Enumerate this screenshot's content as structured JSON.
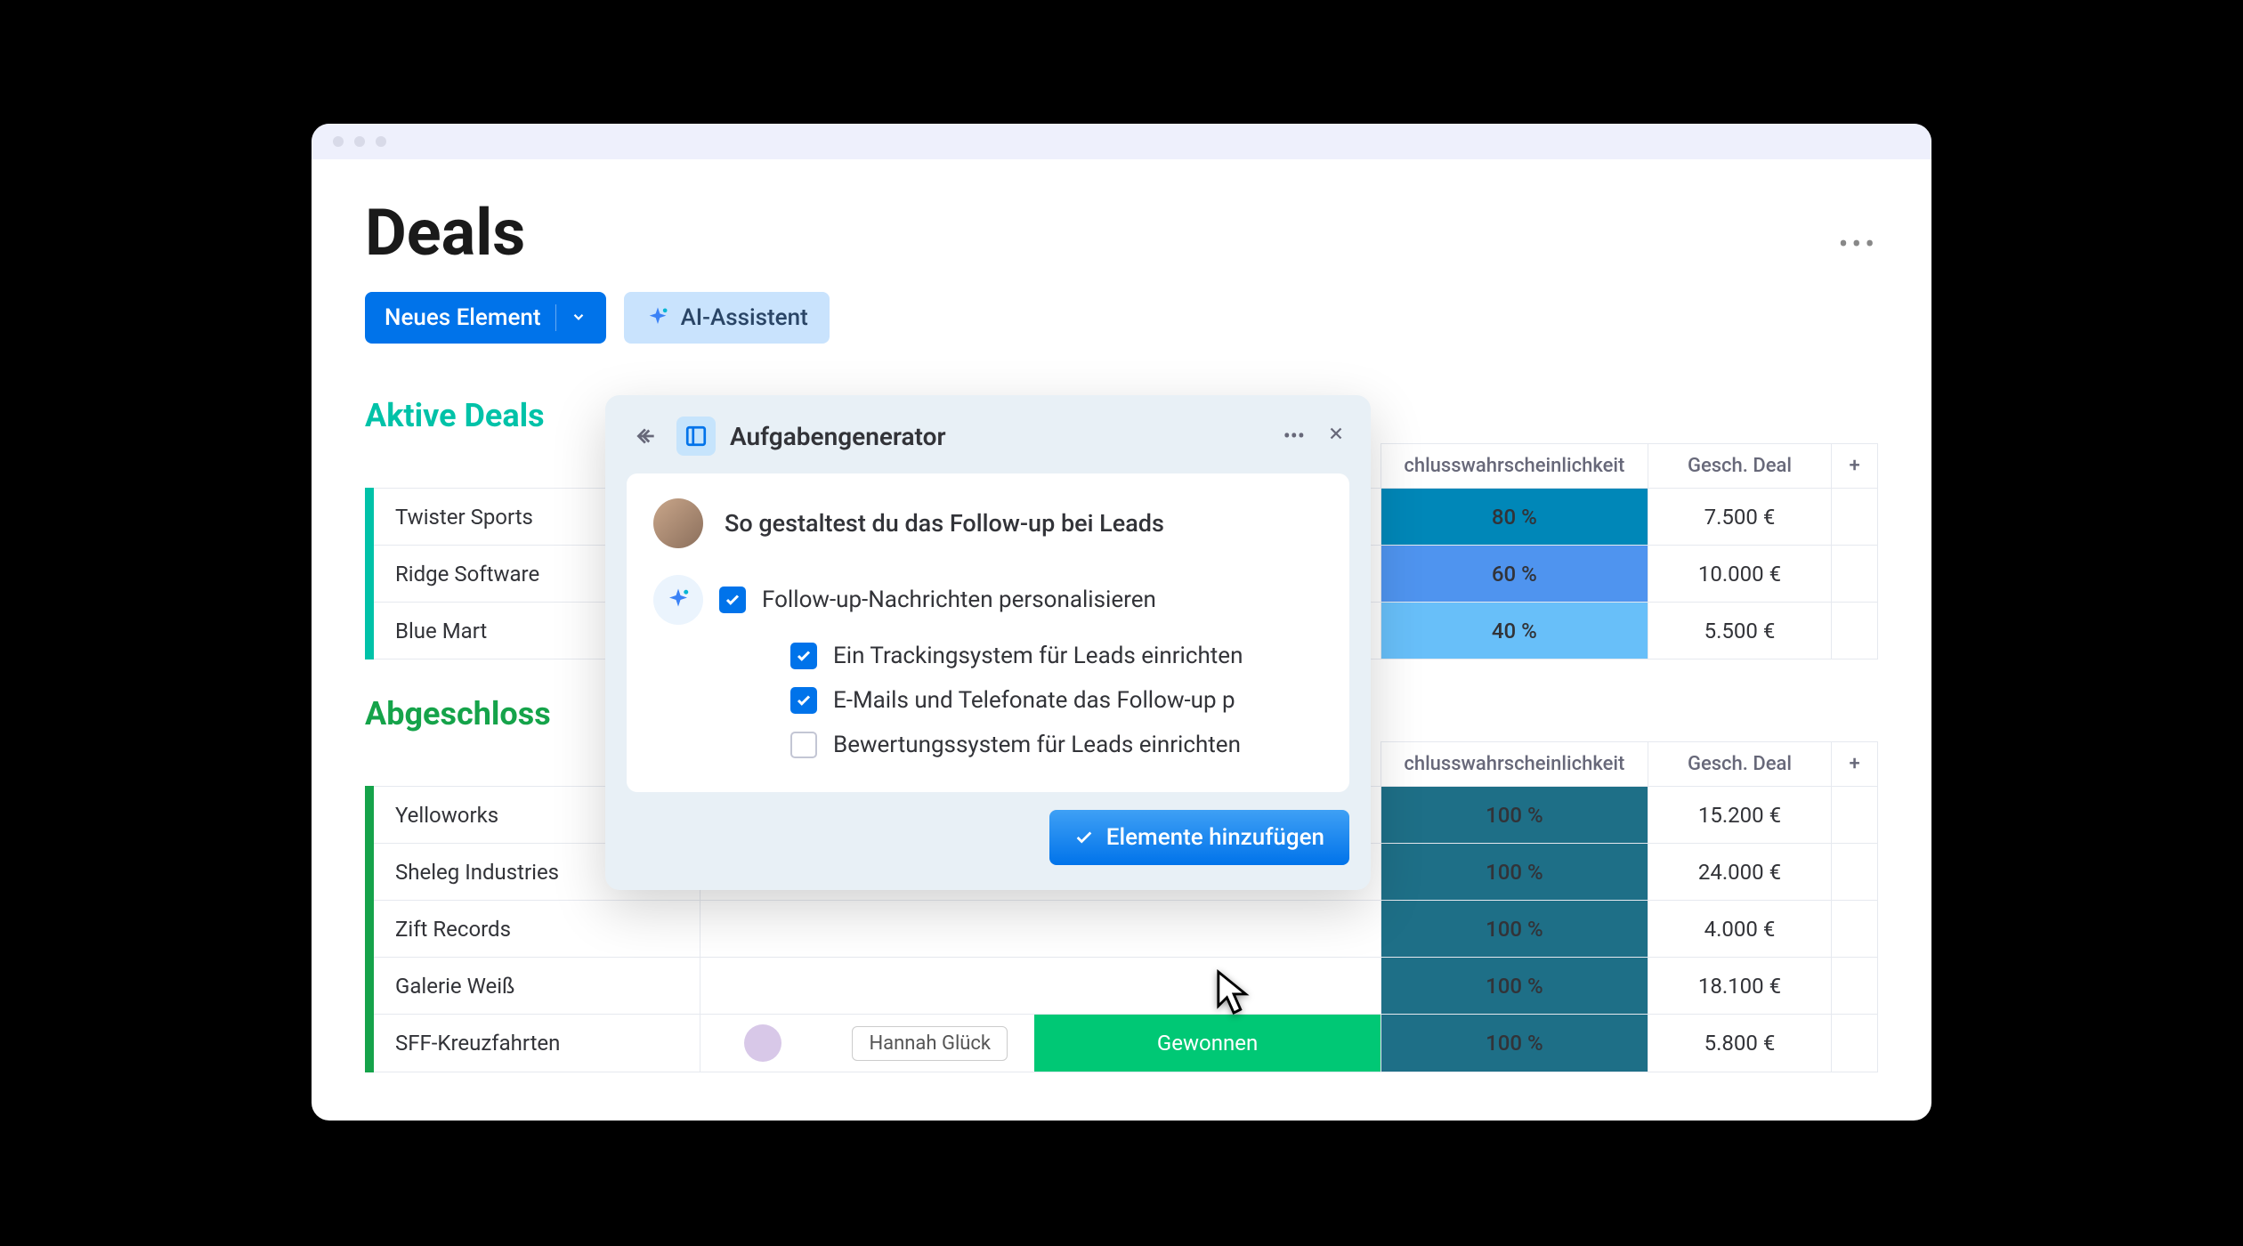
{
  "page_title": "Deals",
  "buttons": {
    "new_element": "Neues Element",
    "ai_assistant": "AI-Assistent"
  },
  "columns": {
    "probability": "chlusswahrscheinlichkeit",
    "deal_value": "Gesch. Deal",
    "add": "+"
  },
  "sections": {
    "active": {
      "title": "Aktive Deals",
      "rows": [
        {
          "name": "Twister Sports",
          "prob": "80 %",
          "prob_color": "#0087B8",
          "value": "7.500 €"
        },
        {
          "name": "Ridge Software",
          "prob": "60 %",
          "prob_color": "#4F94EF",
          "value": "10.000 €"
        },
        {
          "name": "Blue Mart",
          "prob": "40 %",
          "prob_color": "#68BFF9",
          "value": "5.500 €"
        }
      ]
    },
    "closed": {
      "title": "Abgeschloss",
      "rows": [
        {
          "name": "Yelloworks",
          "prob": "100 %",
          "value": "15.200 €"
        },
        {
          "name": "Sheleg Industries",
          "prob": "100 %",
          "value": "24.000 €"
        },
        {
          "name": "Zift Records",
          "prob": "100 %",
          "value": "4.000 €"
        },
        {
          "name": "Galerie Weiß",
          "prob": "100 %",
          "value": "18.100 €"
        },
        {
          "name": "SFF-Kreuzfahrten",
          "owner_tag": "Hannah Glück",
          "status": "Gewonnen",
          "prob": "100 %",
          "value": "5.800 €"
        }
      ]
    }
  },
  "popup": {
    "title": "Aufgabengenerator",
    "heading": "So gestaltest du das Follow-up bei Leads",
    "tasks": [
      {
        "text": "Follow-up-Nachrichten personalisieren",
        "checked": true
      },
      {
        "text": "Ein Trackingsystem für Leads einrichten",
        "checked": true
      },
      {
        "text": "E-Mails und Telefonate das Follow-up p",
        "checked": true
      },
      {
        "text": "Bewertungssystem für Leads einrichten",
        "checked": false
      }
    ],
    "add_button": "Elemente hinzufügen"
  }
}
